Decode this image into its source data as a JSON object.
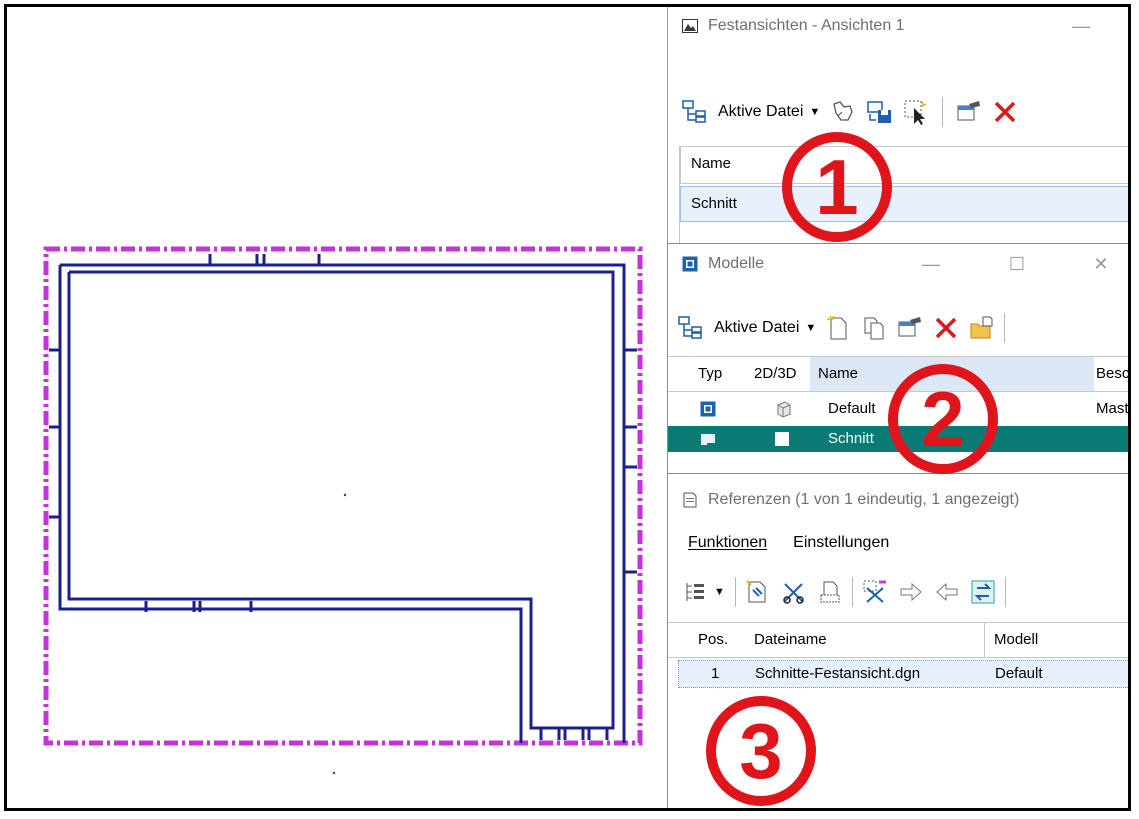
{
  "festansichten": {
    "title": "Festansichten - Ansichten 1",
    "toolbar": {
      "active_file": "Aktive Datei"
    },
    "table": {
      "header": "Name",
      "rows": [
        "Schnitt"
      ]
    }
  },
  "modelle": {
    "title": "Modelle",
    "toolbar": {
      "active_file": "Aktive Datei"
    },
    "table": {
      "headers": [
        "Typ",
        "2D/3D",
        "Name",
        "Besc"
      ],
      "rows": [
        {
          "name": "Default",
          "desc": "Mast"
        },
        {
          "name": "Schnitt",
          "desc": ""
        }
      ]
    }
  },
  "referenzen": {
    "title": "Referenzen (1 von 1 eindeutig, 1 angezeigt)",
    "menu": [
      "Funktionen",
      "Einstellungen"
    ],
    "table": {
      "headers": [
        "Pos.",
        "Dateiname",
        "Modell"
      ],
      "rows": [
        {
          "pos": "1",
          "file": "Schnitte-Festansicht.dgn",
          "model": "Default"
        }
      ]
    }
  },
  "markers": [
    "1",
    "2",
    "3"
  ],
  "colors": {
    "marker_red": "#e0141b",
    "selection_teal": "#0b7a75",
    "drawing_blue": "#1b1f8f",
    "drawing_magenta": "#c433d9"
  }
}
